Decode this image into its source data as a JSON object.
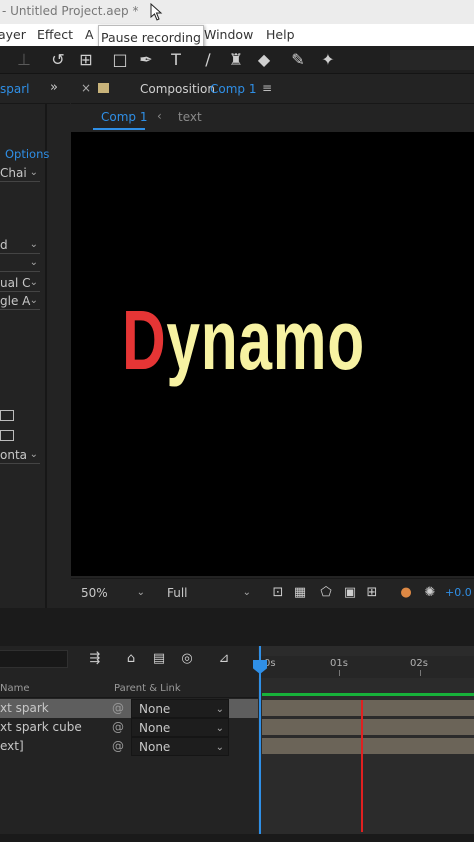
{
  "window": {
    "title": "- Untitled Project.aep *"
  },
  "tooltip": "Pause recording",
  "menu": {
    "items": [
      "ayer",
      "Effect",
      "A",
      "Window",
      "Help"
    ]
  },
  "left_panel": {
    "tab": "sparl",
    "options": "Options",
    "char": "Chai",
    "dd1": "d",
    "dd2": "",
    "dd3": "ual C",
    "dd4": "gle A",
    "dd5": "onta"
  },
  "composition": {
    "panel_label": "Composition",
    "comp_name": "Comp 1",
    "nav_active": "Comp 1",
    "nav_next": "text",
    "text_first": "D",
    "text_rest": "ynamo",
    "colors": {
      "first": "#e53535",
      "rest": "#f7f2a2"
    }
  },
  "viewer_bar": {
    "zoom": "50%",
    "resolution": "Full",
    "exposure": "+0.0"
  },
  "timeline": {
    "header_name": "Name",
    "header_parent": "Parent & Link",
    "ruler": [
      "0s",
      "01s",
      "02s"
    ],
    "layers": [
      {
        "name": "xt spark",
        "parent": "None",
        "selected": true
      },
      {
        "name": "xt spark cube",
        "parent": "None",
        "selected": false
      },
      {
        "name": "ext]",
        "parent": "None",
        "selected": false
      }
    ]
  },
  "icons": {
    "toolbar": [
      "pin-icon",
      "rotate-icon",
      "camera-orbit-icon",
      "rectangle-icon",
      "pen-icon",
      "type-icon",
      "brush-icon",
      "stamp-icon",
      "eraser-icon",
      "roto-icon",
      "puppet-icon"
    ],
    "timeline_tools": [
      "graph-icon",
      "shy-icon",
      "frame-blend-icon",
      "motion-blur-icon",
      "graph-editor-icon"
    ]
  }
}
